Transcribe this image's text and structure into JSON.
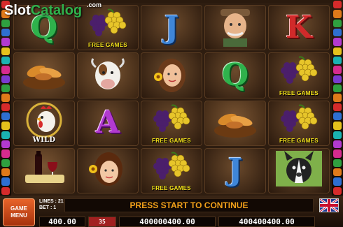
{
  "logo": {
    "brand_a": "Slot",
    "brand_b": "Catalog",
    "tld": ".com"
  },
  "sidebar": {
    "left": [
      "1",
      "2",
      "3",
      "4",
      "5",
      "6",
      "7",
      "8",
      "9",
      "10",
      "11",
      "12",
      "13",
      "14",
      "15",
      "16",
      "17",
      "18",
      "19",
      "20",
      "21"
    ],
    "right": [
      "1",
      "2",
      "3",
      "4",
      "5",
      "6",
      "7",
      "8",
      "9",
      "10",
      "11",
      "12",
      "13",
      "14",
      "15",
      "16",
      "17",
      "18",
      "19",
      "20",
      "21"
    ],
    "colors": [
      "#d62b2b",
      "#e07a1a",
      "#2fa03f",
      "#2e6fd1",
      "#b23ad0",
      "#e5c21c",
      "#1ab2b2",
      "#d62b8e",
      "#7a3ad0",
      "#2fa03f",
      "#e07a1a",
      "#d62b2b",
      "#2e6fd1",
      "#e5c21c",
      "#1ab2b2",
      "#b23ad0",
      "#d62b8e",
      "#2fa03f",
      "#e07a1a",
      "#2e6fd1",
      "#d62b2b"
    ]
  },
  "reels": [
    [
      {
        "sym": "Q"
      },
      {
        "sym": "grapes",
        "label": "FREE GAMES"
      },
      {
        "sym": "J"
      },
      {
        "sym": "farmer"
      },
      {
        "sym": "K"
      }
    ],
    [
      {
        "sym": "bread"
      },
      {
        "sym": "cow"
      },
      {
        "sym": "woman"
      },
      {
        "sym": "Q"
      },
      {
        "sym": "grapes",
        "label": "FREE GAMES"
      }
    ],
    [
      {
        "sym": "rooster",
        "label": "WILD"
      },
      {
        "sym": "A"
      },
      {
        "sym": "grapes",
        "label": "FREE GAMES"
      },
      {
        "sym": "bread"
      },
      {
        "sym": "grapes",
        "label": "FREE GAMES"
      }
    ],
    [
      {
        "sym": "wine"
      },
      {
        "sym": "girl"
      },
      {
        "sym": "grapes",
        "label": "FREE GAMES"
      },
      {
        "sym": "J"
      },
      {
        "sym": "dog"
      }
    ]
  ],
  "bottom": {
    "menu_line1": "GAME",
    "menu_line2": "MENU",
    "lines_label": "LINES : 21",
    "bet_label": "BET : 1",
    "message": "PRESS START TO CONTINUE",
    "counter_left": "400.00",
    "counter_red": "35",
    "counter_mid": "400000400.00",
    "counter_right": "400400400.00"
  }
}
